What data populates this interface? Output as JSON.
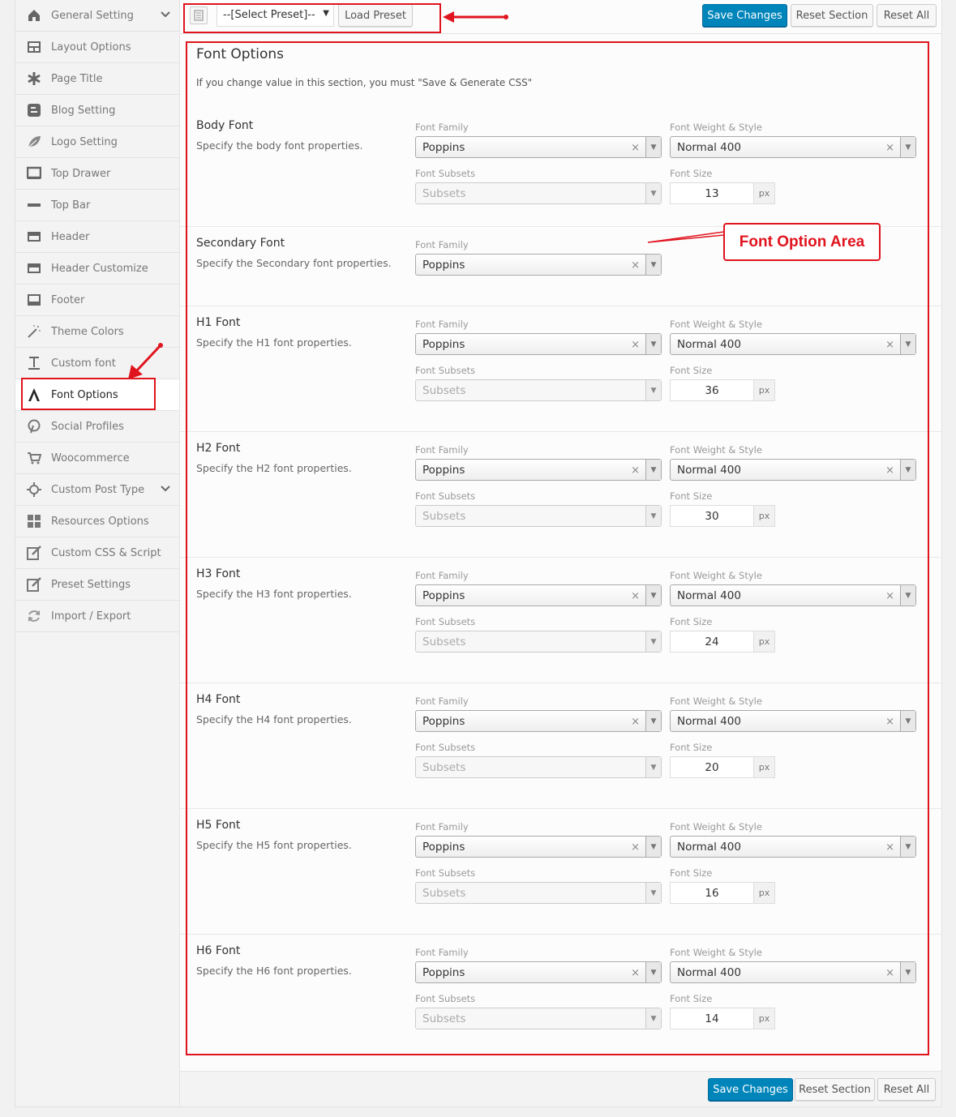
{
  "sidebar": {
    "items": [
      {
        "label": "General Setting",
        "icon": "home-icon",
        "chevron": true
      },
      {
        "label": "Layout Options",
        "icon": "layout-icon"
      },
      {
        "label": "Page Title",
        "icon": "asterisk-icon"
      },
      {
        "label": "Blog Setting",
        "icon": "blogger-icon"
      },
      {
        "label": "Logo Setting",
        "icon": "leaf-icon"
      },
      {
        "label": "Top Drawer",
        "icon": "monitor-icon"
      },
      {
        "label": "Top Bar",
        "icon": "minus-icon"
      },
      {
        "label": "Header",
        "icon": "header-icon"
      },
      {
        "label": "Header Customize",
        "icon": "header-customize-icon"
      },
      {
        "label": "Footer",
        "icon": "footer-icon"
      },
      {
        "label": "Theme Colors",
        "icon": "magic-wand-icon"
      },
      {
        "label": "Custom font",
        "icon": "text-cursor-icon"
      },
      {
        "label": "Font Options",
        "icon": "font-a-icon",
        "active": true
      },
      {
        "label": "Social Profiles",
        "icon": "pinterest-icon"
      },
      {
        "label": "Woocommerce",
        "icon": "cart-icon"
      },
      {
        "label": "Custom Post Type",
        "icon": "crosshair-icon",
        "chevron": true
      },
      {
        "label": "Resources Options",
        "icon": "grid-icon"
      },
      {
        "label": "Custom CSS & Script",
        "icon": "edit-icon"
      },
      {
        "label": "Preset Settings",
        "icon": "edit-icon"
      },
      {
        "label": "Import / Export",
        "icon": "refresh-icon"
      }
    ]
  },
  "toolbar": {
    "preset_placeholder": "--[Select Preset]--",
    "load_preset": "Load Preset",
    "save_changes": "Save Changes",
    "reset_section": "Reset Section",
    "reset_all": "Reset All"
  },
  "section": {
    "title": "Font Options",
    "description": "If you change value in this section, you must \"Save & Generate CSS\""
  },
  "labels": {
    "font_family": "Font Family",
    "font_weight": "Font Weight & Style",
    "font_subsets": "Font Subsets",
    "font_size": "Font Size",
    "subsets_placeholder": "Subsets",
    "unit": "px",
    "clear": "×"
  },
  "fonts": [
    {
      "title": "Body Font",
      "desc": "Specify the body font properties.",
      "family": "Poppins",
      "weight": "Normal 400",
      "size": "13"
    },
    {
      "title": "Secondary Font",
      "desc": "Specify the Secondary font properties.",
      "family": "Poppins"
    },
    {
      "title": "H1 Font",
      "desc": "Specify the H1 font properties.",
      "family": "Poppins",
      "weight": "Normal 400",
      "size": "36"
    },
    {
      "title": "H2 Font",
      "desc": "Specify the H2 font properties.",
      "family": "Poppins",
      "weight": "Normal 400",
      "size": "30"
    },
    {
      "title": "H3 Font",
      "desc": "Specify the H3 font properties.",
      "family": "Poppins",
      "weight": "Normal 400",
      "size": "24"
    },
    {
      "title": "H4 Font",
      "desc": "Specify the H4 font properties.",
      "family": "Poppins",
      "weight": "Normal 400",
      "size": "20"
    },
    {
      "title": "H5 Font",
      "desc": "Specify the H5 font properties.",
      "family": "Poppins",
      "weight": "Normal 400",
      "size": "16"
    },
    {
      "title": "H6 Font",
      "desc": "Specify the H6 font properties.",
      "family": "Poppins",
      "weight": "Normal 400",
      "size": "14"
    }
  ],
  "annotation": {
    "callout": "Font Option Area",
    "color": "#e0141e"
  },
  "colors": {
    "primary_button": "#0085ba"
  }
}
